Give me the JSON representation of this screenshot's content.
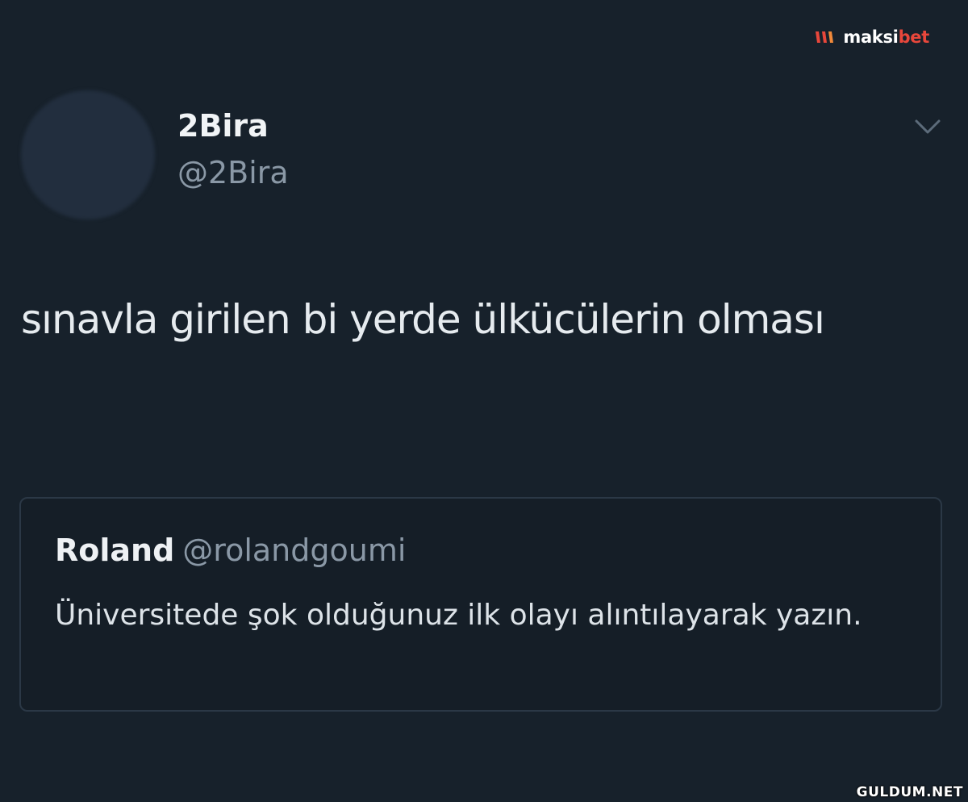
{
  "watermark": {
    "brand_main": "maksi",
    "brand_accent": "bet",
    "accent_color": "#e8473b"
  },
  "tweet": {
    "display_name": "2Bira",
    "handle": "@2Bira",
    "text": "sınavla girilen bi yerde ülkücülerin olması",
    "menu_icon": "chevron-down-icon"
  },
  "quoted_tweet": {
    "display_name": "Roland",
    "handle": "@rolandgoumi",
    "text": "Üniversitede şok olduğunuz ilk olayı alıntılayarak yazın."
  },
  "site_mark": "GULDUM.NET",
  "colors": {
    "background": "#17212b",
    "card_border": "#2b3846",
    "secondary_text": "#8a98a6"
  }
}
